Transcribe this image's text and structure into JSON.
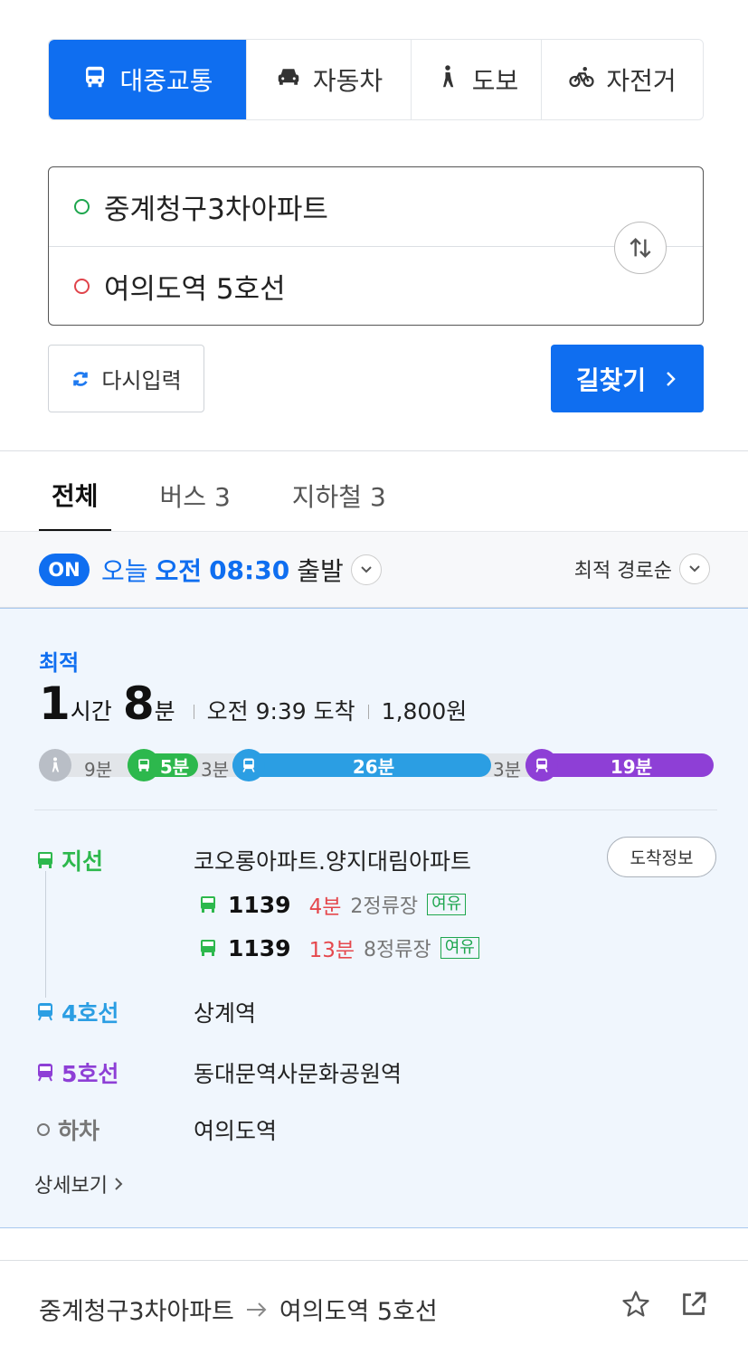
{
  "modes": [
    {
      "label": "대중교통",
      "icon": "bus-icon",
      "active": true
    },
    {
      "label": "자동차",
      "icon": "car-icon",
      "active": false
    },
    {
      "label": "도보",
      "icon": "walk-icon",
      "active": false
    },
    {
      "label": "자전거",
      "icon": "bicycle-icon",
      "active": false
    }
  ],
  "search": {
    "origin": "중계청구3차아파트",
    "destination": "여의도역 5호선"
  },
  "actions": {
    "reset_label": "다시입력",
    "search_label": "길찾기"
  },
  "result_tabs": [
    {
      "label": "전체",
      "active": true
    },
    {
      "label": "버스 3",
      "active": false
    },
    {
      "label": "지하철 3",
      "active": false
    }
  ],
  "timebar": {
    "badge": "ON",
    "today": "오늘",
    "ampm": "오전",
    "time": "08:30",
    "suffix": "출발",
    "sort_label": "최적 경로순"
  },
  "route": {
    "tag": "최적",
    "hours": "1",
    "hours_unit": "시간",
    "minutes": "8",
    "minutes_unit": "분",
    "arrival": "오전 9:39 도착",
    "fare": "1,800원",
    "segments": [
      {
        "type": "walk",
        "label": "9분",
        "color": "#b9bec6"
      },
      {
        "type": "bus",
        "label": "5분",
        "color": "#2db84d"
      },
      {
        "type": "walk",
        "label": "3분",
        "color": "#b9bec6"
      },
      {
        "type": "subway4",
        "label": "26분",
        "color": "#2b9ee3"
      },
      {
        "type": "walk",
        "label": "3분",
        "color": "#b9bec6"
      },
      {
        "type": "subway5",
        "label": "19분",
        "color": "#8e3fd6"
      }
    ],
    "steps": [
      {
        "line": "지선",
        "stop": "코오롱아파트.양지대림아파트",
        "color": "#2db84d"
      },
      {
        "line": "4호선",
        "stop": "상계역",
        "color": "#2b9ee3"
      },
      {
        "line": "5호선",
        "stop": "동대문역사문화공원역",
        "color": "#8e3fd6"
      },
      {
        "line": "하차",
        "stop": "여의도역",
        "color": "#777777"
      }
    ],
    "arrival_info_label": "도착정보",
    "buses": [
      {
        "number": "1139",
        "minutes": "4분",
        "stops": "2정류장",
        "crowd": "여유"
      },
      {
        "number": "1139",
        "minutes": "13분",
        "stops": "8정류장",
        "crowd": "여유"
      }
    ],
    "detail_label": "상세보기"
  },
  "bottom": {
    "from": "중계청구3차아파트",
    "to": "여의도역 5호선"
  }
}
